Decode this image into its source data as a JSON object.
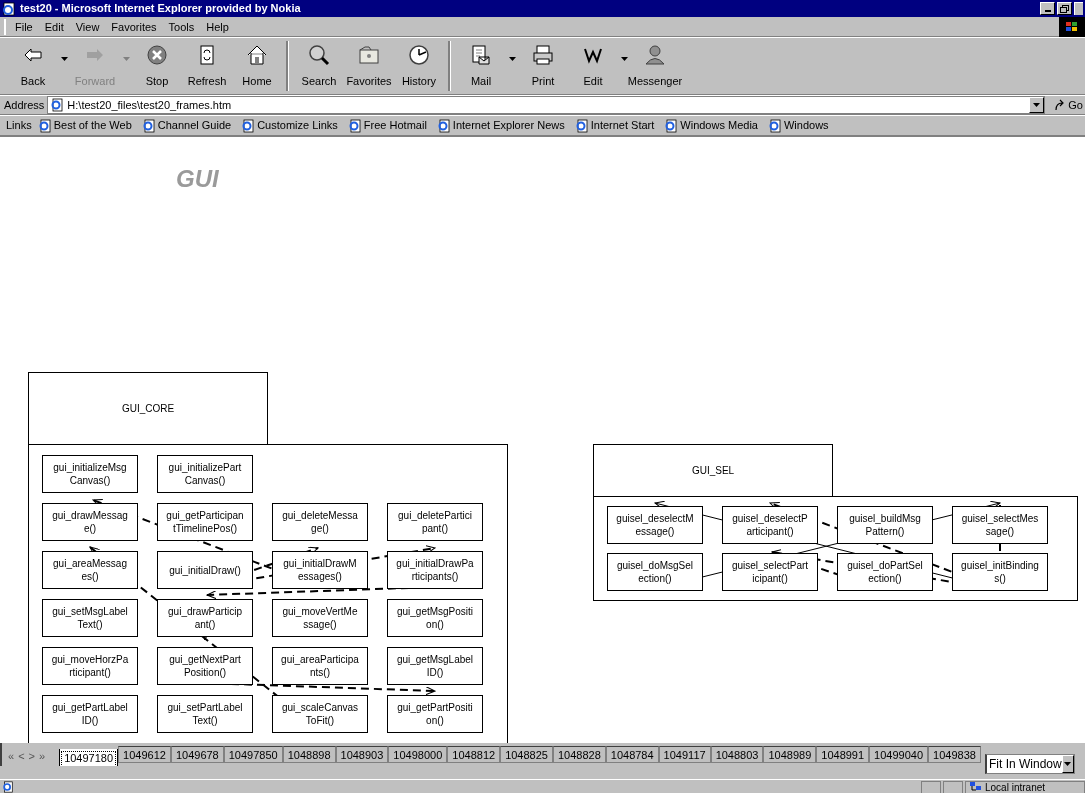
{
  "window": {
    "title": "test20 - Microsoft Internet Explorer provided by Nokia"
  },
  "menu": [
    "File",
    "Edit",
    "View",
    "Favorites",
    "Tools",
    "Help"
  ],
  "toolbar": [
    {
      "kind": "back",
      "label": "Back",
      "dropdown": true,
      "disabled": false,
      "separator_after": false
    },
    {
      "kind": "forward",
      "label": "Forward",
      "dropdown": true,
      "disabled": true,
      "separator_after": false
    },
    {
      "kind": "stop",
      "label": "Stop",
      "dropdown": false,
      "disabled": false,
      "separator_after": false
    },
    {
      "kind": "refresh",
      "label": "Refresh",
      "dropdown": false,
      "disabled": false,
      "separator_after": false
    },
    {
      "kind": "home",
      "label": "Home",
      "dropdown": false,
      "disabled": false,
      "separator_after": true
    },
    {
      "kind": "search",
      "label": "Search",
      "dropdown": false,
      "disabled": false,
      "separator_after": false
    },
    {
      "kind": "favorites",
      "label": "Favorites",
      "dropdown": false,
      "disabled": false,
      "separator_after": false
    },
    {
      "kind": "history",
      "label": "History",
      "dropdown": false,
      "disabled": false,
      "separator_after": true
    },
    {
      "kind": "mail",
      "label": "Mail",
      "dropdown": true,
      "disabled": false,
      "separator_after": false
    },
    {
      "kind": "print",
      "label": "Print",
      "dropdown": false,
      "disabled": false,
      "separator_after": false
    },
    {
      "kind": "edit",
      "label": "Edit",
      "dropdown": true,
      "disabled": false,
      "separator_after": false
    },
    {
      "kind": "messenger",
      "label": "Messenger",
      "dropdown": false,
      "disabled": false,
      "separator_after": false
    }
  ],
  "address": {
    "label": "Address",
    "value": "H:\\test20_files\\test20_frames.htm",
    "go": "Go"
  },
  "links": {
    "label": "Links",
    "items": [
      "Best of the Web",
      "Channel Guide",
      "Customize Links",
      "Free Hotmail",
      "Internet Explorer News",
      "Internet Start",
      "Windows Media",
      "Windows"
    ]
  },
  "page": {
    "heading": "GUI",
    "packages": [
      {
        "name": "GUI_CORE",
        "rows": [
          [
            "gui_initializeMsgCanvas()",
            "gui_initializePartCanvas()"
          ],
          [
            "gui_drawMessage()",
            "gui_getParticipantTimelinePos()",
            "gui_deleteMessage()",
            "gui_deleteParticipant()"
          ],
          [
            "gui_areaMessages()",
            "gui_initialDraw()",
            "gui_initialDrawMessages()",
            "gui_initialDrawParticipants()"
          ],
          [
            "gui_setMsgLabelText()",
            "gui_drawParticipant()",
            "gui_moveVertMessage()",
            "gui_getMsgPosition()"
          ],
          [
            "gui_moveHorzParticipant()",
            "gui_getNextPartPosition()",
            "gui_areaParticipants()",
            "gui_getMsgLabelID()"
          ],
          [
            "gui_getPartLabelID()",
            "gui_setPartLabelText()",
            "gui_scaleCanvasToFit()",
            "gui_getPartPosition()"
          ]
        ]
      },
      {
        "name": "GUI_SEL",
        "rows": [
          [
            "guisel_deselectMessage()",
            "guisel_deselectParticipant()",
            "guisel_buildMsgPattern()",
            "guisel_selectMessage()"
          ],
          [
            "guisel_doMsgSelection()",
            "guisel_selectParticipant()",
            "guisel_doPartSelection()",
            "guisel_initBindings()"
          ]
        ]
      }
    ]
  },
  "page_tabs": {
    "nav": [
      "«",
      "<",
      ">",
      "»"
    ],
    "tabs": [
      {
        "label": "10497180",
        "selected": true
      },
      {
        "label": "1049612",
        "selected": false
      },
      {
        "label": "1049678",
        "selected": false
      },
      {
        "label": "10497850",
        "selected": false
      },
      {
        "label": "1048898",
        "selected": false
      },
      {
        "label": "1048903",
        "selected": false
      },
      {
        "label": "10498000",
        "selected": false
      },
      {
        "label": "1048812",
        "selected": false
      },
      {
        "label": "1048825",
        "selected": false
      },
      {
        "label": "1048828",
        "selected": false
      },
      {
        "label": "1048784",
        "selected": false
      },
      {
        "label": "1049117",
        "selected": false
      },
      {
        "label": "1048803",
        "selected": false
      },
      {
        "label": "1048989",
        "selected": false
      },
      {
        "label": "1048991",
        "selected": false
      },
      {
        "label": "10499040",
        "selected": false
      },
      {
        "label": "1049838",
        "selected": false
      }
    ],
    "zoom": "Fit In Window"
  },
  "status_bar": {
    "zone": "Local intranet"
  }
}
